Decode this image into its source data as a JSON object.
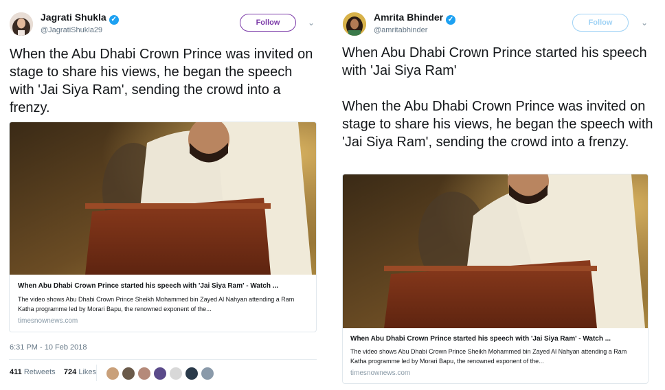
{
  "tweet_left": {
    "name": "Jagrati Shukla",
    "handle": "@JagratiShukla29",
    "follow_label": "Follow",
    "text": "When the Abu Dhabi Crown Prince was invited on stage to share his views, he began the speech with 'Jai Siya Ram', sending the crowd into a frenzy.",
    "card": {
      "title": "When Abu Dhabi Crown Prince started his speech with 'Jai Siya Ram' - Watch ...",
      "description": "The video shows Abu Dhabi Crown Prince Sheikh Mohammed bin Zayed Al Nahyan attending a Ram Katha programme led by Morari Bapu, the renowned exponent of the...",
      "domain": "timesnownews.com"
    },
    "timestamp": "6:31 PM - 10 Feb 2018",
    "retweets_count": "411",
    "retweets_label": "Retweets",
    "likes_count": "724",
    "likes_label": "Likes"
  },
  "tweet_right": {
    "name": "Amrita Bhinder",
    "handle": "@amritabhinder",
    "follow_label": "Follow",
    "text": "When Abu Dhabi Crown Prince started his speech with 'Jai Siya Ram'\n\nWhen the Abu Dhabi Crown Prince was invited on stage to share his views, he began the speech with 'Jai Siya Ram', sending the crowd into a frenzy.",
    "card": {
      "title": "When Abu Dhabi Crown Prince started his speech with 'Jai Siya Ram' - Watch ...",
      "description": "The video shows Abu Dhabi Crown Prince Sheikh Mohammed bin Zayed Al Nahyan attending a Ram Katha programme led by Morari Bapu, the renowned exponent of the...",
      "domain": "timesnownews.com"
    }
  },
  "colors": {
    "verified": "#1da1f2",
    "follow_dark": "#7b3aa8",
    "follow_light": "#9fd2f5",
    "secondary_text": "#657786"
  },
  "icons": [
    "verified-badge-icon",
    "chevron-down-icon"
  ]
}
